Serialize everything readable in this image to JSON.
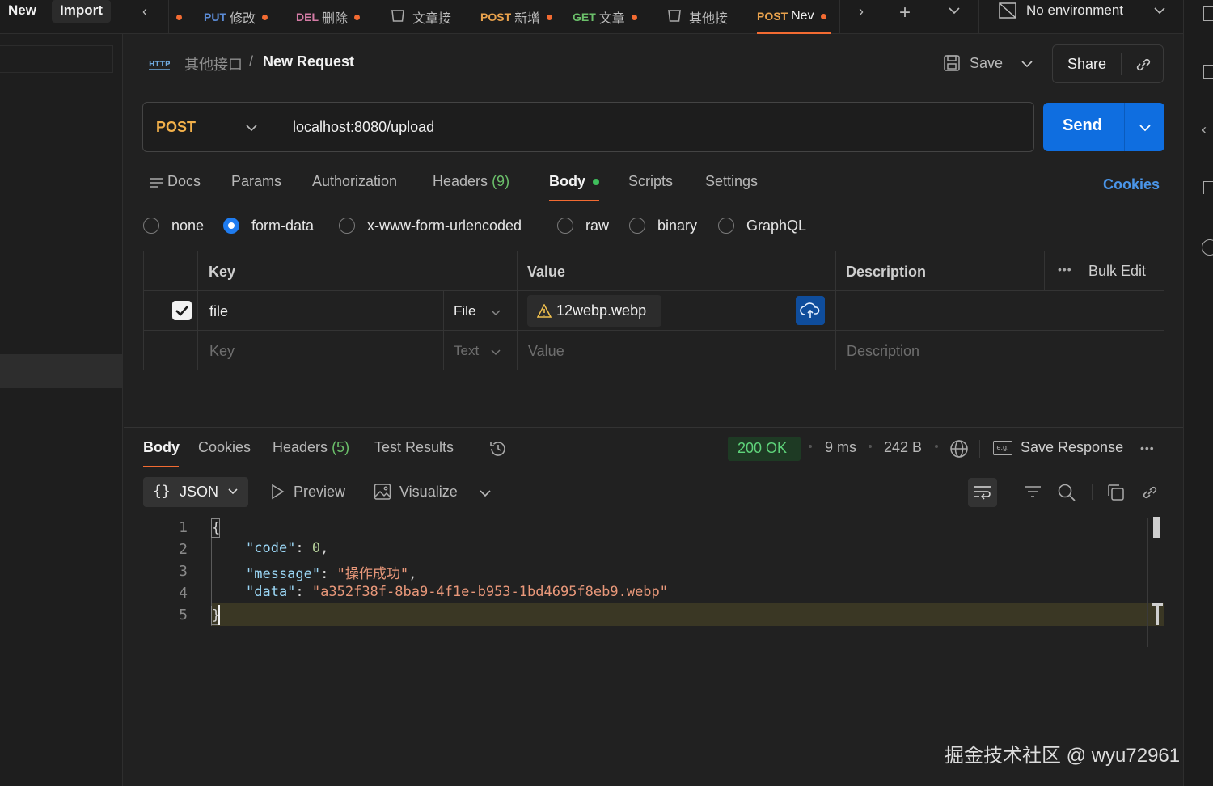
{
  "topbar": {
    "new_label": "New",
    "import_label": "Import",
    "tabs": [
      {
        "method": "PUT",
        "name": "修改",
        "method_color": "#5b8bd6",
        "dirty": true
      },
      {
        "method": "DEL",
        "name": "删除",
        "method_color": "#d47ba5",
        "dirty": true
      },
      {
        "method": "",
        "name": "文章接",
        "method_color": "",
        "dirty": false
      },
      {
        "method": "POST",
        "name": "新增",
        "method_color": "#e9a24d",
        "dirty": true
      },
      {
        "method": "GET",
        "name": "文章",
        "method_color": "#6bbf6a",
        "dirty": true
      },
      {
        "method": "",
        "name": "其他接",
        "method_color": "",
        "dirty": false
      },
      {
        "method": "POST",
        "name": "Nev",
        "method_color": "#e9a24d",
        "dirty": true
      }
    ],
    "environment": "No environment"
  },
  "header": {
    "protocol_icon": "HTTP",
    "collection": "其他接口",
    "separator": "/",
    "request_name": "New Request",
    "save_label": "Save",
    "share_label": "Share"
  },
  "request": {
    "method": "POST",
    "method_color": "#f2b04a",
    "url": "localhost:8080/upload",
    "send_label": "Send"
  },
  "request_tabs": {
    "docs": "Docs",
    "params": "Params",
    "authorization": "Authorization",
    "headers": "Headers",
    "headers_count": "(9)",
    "body": "Body",
    "scripts": "Scripts",
    "settings": "Settings",
    "cookies": "Cookies",
    "active": "Body"
  },
  "body_types": {
    "options": [
      "none",
      "form-data",
      "x-www-form-urlencoded",
      "raw",
      "binary",
      "GraphQL"
    ],
    "selected": "form-data"
  },
  "form_table": {
    "headers": {
      "key": "Key",
      "value": "Value",
      "description": "Description",
      "bulk_edit": "Bulk Edit"
    },
    "rows": [
      {
        "checked": true,
        "key": "file",
        "type": "File",
        "value": "12webp.webp",
        "description": ""
      }
    ],
    "placeholder": {
      "key": "Key",
      "type": "Text",
      "value": "Value",
      "description": "Description"
    }
  },
  "response": {
    "tabs": {
      "body": "Body",
      "cookies": "Cookies",
      "headers": "Headers",
      "headers_count": "(5)",
      "test_results": "Test Results"
    },
    "status": "200 OK",
    "time": "9 ms",
    "size": "242 B",
    "save_response": "Save Response",
    "format": "JSON",
    "preview": "Preview",
    "visualize": "Visualize",
    "line_numbers": [
      "1",
      "2",
      "3",
      "4",
      "5"
    ],
    "json": {
      "open": "{",
      "code_key": "\"code\"",
      "code_val": "0",
      "message_key": "\"message\"",
      "message_val": "\"操作成功\"",
      "data_key": "\"data\"",
      "data_val": "\"a352f38f-8ba9-4f1e-b953-1bd4695f8eb9.webp\"",
      "close": "}"
    }
  },
  "watermark": "掘金技术社区 @ wyu72961"
}
